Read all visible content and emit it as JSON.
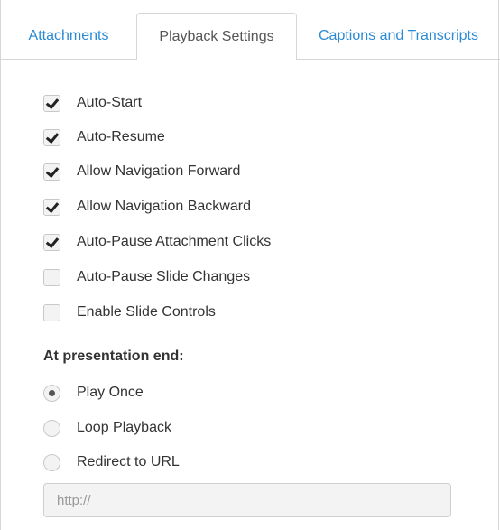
{
  "tabs": [
    {
      "label": "Attachments",
      "active": false
    },
    {
      "label": "Playback Settings",
      "active": true
    },
    {
      "label": "Captions and Transcripts",
      "active": false
    }
  ],
  "checkboxes": [
    {
      "label": "Auto-Start",
      "checked": true
    },
    {
      "label": "Auto-Resume",
      "checked": true
    },
    {
      "label": "Allow Navigation Forward",
      "checked": true
    },
    {
      "label": "Allow Navigation Backward",
      "checked": true
    },
    {
      "label": "Auto-Pause Attachment Clicks",
      "checked": true
    },
    {
      "label": "Auto-Pause Slide Changes",
      "checked": false
    },
    {
      "label": "Enable Slide Controls",
      "checked": false
    }
  ],
  "presentation_end": {
    "title": "At presentation end:",
    "options": [
      {
        "label": "Play Once",
        "selected": true
      },
      {
        "label": "Loop Playback",
        "selected": false
      },
      {
        "label": "Redirect to URL",
        "selected": false
      }
    ],
    "url_placeholder": "http://",
    "url_value": ""
  },
  "colors": {
    "link": "#2a8ad4",
    "border": "#d6d6d6",
    "text": "#333333",
    "control_bg": "#f3f3f3"
  },
  "icons": {
    "checked": "checkmark-icon",
    "radio_selected": "radio-dot-icon"
  }
}
